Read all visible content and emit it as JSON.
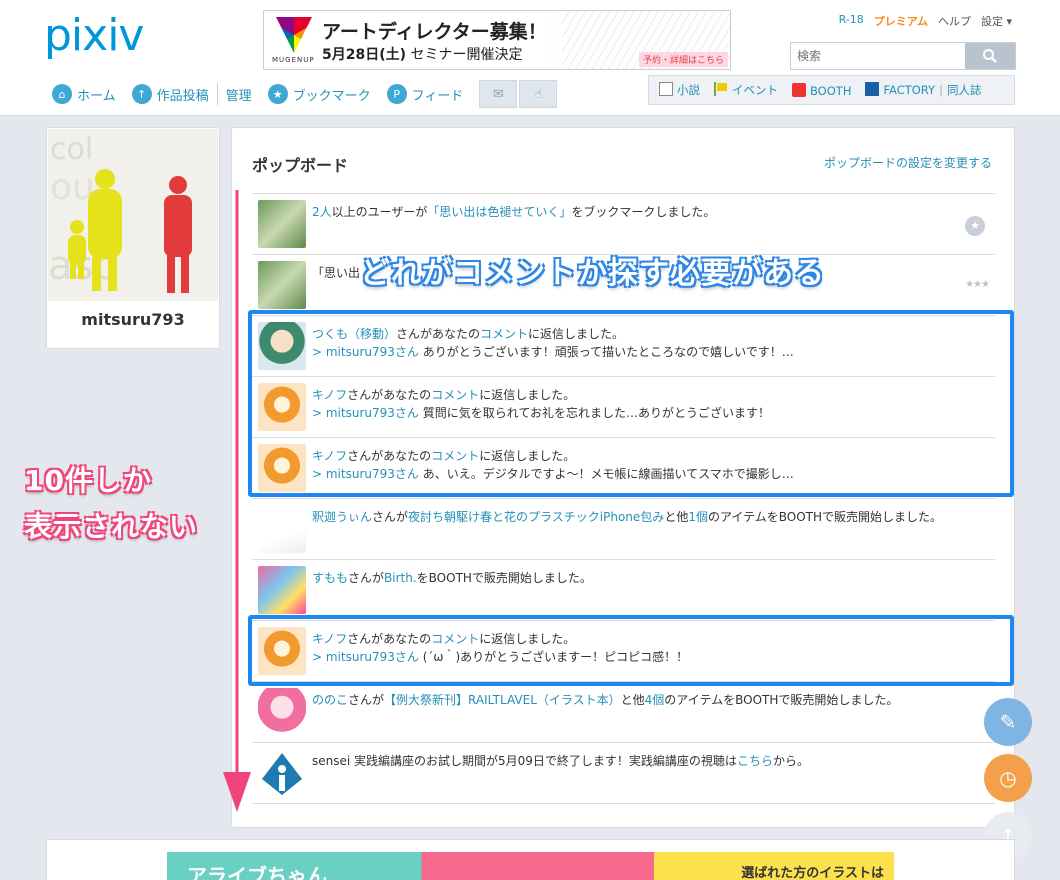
{
  "header": {
    "logo": "pixiv",
    "banner": {
      "brand": "MUGENUP",
      "title": "アートディレクター募集！",
      "subtitle_date": "5月28日(土)",
      "subtitle_rest": "セミナー開催決定",
      "cta": "予約・詳細はこちら"
    },
    "top_links": {
      "r18": "R-18",
      "premium": "プレミアム",
      "help": "ヘルプ",
      "settings": "設定 ▾"
    },
    "search": {
      "placeholder": "検索"
    },
    "nav": [
      {
        "label": "ホーム",
        "icon": "home-icon"
      },
      {
        "label": "作品投稿",
        "icon": "upload-icon"
      },
      {
        "label": "管理"
      },
      {
        "label": "ブックマーク",
        "icon": "star-icon"
      },
      {
        "label": "フィード",
        "icon": "feed-icon"
      }
    ],
    "right_nav": {
      "novel": "小説",
      "event": "イベント",
      "booth": "BOOTH",
      "factory": "FACTORY",
      "doujin": "同人誌"
    }
  },
  "profile": {
    "username": "mitsuru793"
  },
  "popboard": {
    "title": "ポップボード",
    "settings_link": "ポップボードの設定を変更する",
    "rows": [
      {
        "line1": [
          {
            "t": "2人",
            "link": true
          },
          {
            "t": "以上のユーザーが"
          },
          {
            "t": "「思い出は色褪せていく」",
            "link": true
          },
          {
            "t": "をブックマークしました。"
          }
        ],
        "line2": [],
        "badge": "star"
      },
      {
        "line1": [
          {
            "t": "「思い出"
          }
        ],
        "line2": [],
        "badge": "stars3"
      },
      {
        "line1": [
          {
            "t": "つくも（移動）",
            "link": true
          },
          {
            "t": "さんがあなたの"
          },
          {
            "t": "コメント",
            "link": true
          },
          {
            "t": "に返信しました。"
          }
        ],
        "line2": [
          {
            "t": "> mitsuru793さん",
            "link": true
          },
          {
            "t": " ありがとうございます！頑張って描いたところなので嬉しいです！…"
          }
        ]
      },
      {
        "line1": [
          {
            "t": "キノフ",
            "link": true
          },
          {
            "t": "さんがあなたの"
          },
          {
            "t": "コメント",
            "link": true
          },
          {
            "t": "に返信しました。"
          }
        ],
        "line2": [
          {
            "t": "> mitsuru793さん",
            "link": true
          },
          {
            "t": " 質問に気を取られてお礼を忘れました…ありがとうございます！"
          }
        ]
      },
      {
        "line1": [
          {
            "t": "キノフ",
            "link": true
          },
          {
            "t": "さんがあなたの"
          },
          {
            "t": "コメント",
            "link": true
          },
          {
            "t": "に返信しました。"
          }
        ],
        "line2": [
          {
            "t": "> mitsuru793さん",
            "link": true
          },
          {
            "t": " あ、いえ。デジタルですよ〜！メモ帳に線画描いてスマホで撮影し…"
          }
        ]
      },
      {
        "line1": [
          {
            "t": "釈迦うぃん",
            "link": true
          },
          {
            "t": "さんが"
          },
          {
            "t": "夜討ち朝駆け春と花のプラスチックiPhone包み",
            "link": true
          },
          {
            "t": "と他"
          },
          {
            "t": "1個",
            "link": true
          },
          {
            "t": "のアイテムをBOOTHで販売開始しました。"
          }
        ],
        "line2": []
      },
      {
        "line1": [
          {
            "t": "すもも",
            "link": true
          },
          {
            "t": "さんが"
          },
          {
            "t": "Birth.",
            "link": true
          },
          {
            "t": "をBOOTHで販売開始しました。"
          }
        ],
        "line2": []
      },
      {
        "line1": [
          {
            "t": "キノフ",
            "link": true
          },
          {
            "t": "さんがあなたの"
          },
          {
            "t": "コメント",
            "link": true
          },
          {
            "t": "に返信しました。"
          }
        ],
        "line2": [
          {
            "t": "> mitsuru793さん",
            "link": true
          },
          {
            "t": " (´ω｀)ありがとうございますー！ピコピコ感！！"
          }
        ]
      },
      {
        "line1": [
          {
            "t": "ののこ",
            "link": true
          },
          {
            "t": "さんが"
          },
          {
            "t": "【例大祭新刊】RAILTLAVEL（イラスト本）",
            "link": true
          },
          {
            "t": "と他"
          },
          {
            "t": "4個",
            "link": true
          },
          {
            "t": "のアイテムをBOOTHで販売開始しました。"
          }
        ],
        "line2": []
      },
      {
        "line1": [
          {
            "t": "sensei 実践編講座のお試し期間が5月09日で終了します！実践編講座の視聴は"
          },
          {
            "t": "こちら",
            "link": true
          },
          {
            "t": "から。"
          }
        ],
        "line2": []
      }
    ]
  },
  "annotations": {
    "comment_note": "どれがコメントか探す必要がある",
    "limit_note_line1": "10件しか",
    "limit_note_line2": "表示されない"
  },
  "bottom_ad": {
    "left_text": "アライブちゃん",
    "right_text": "選ばれた方のイラストは"
  },
  "colors": {
    "accent": "#258fb8",
    "highlight": "#1e88f0",
    "arrow": "#f0457a",
    "premium": "#f68a1f"
  }
}
